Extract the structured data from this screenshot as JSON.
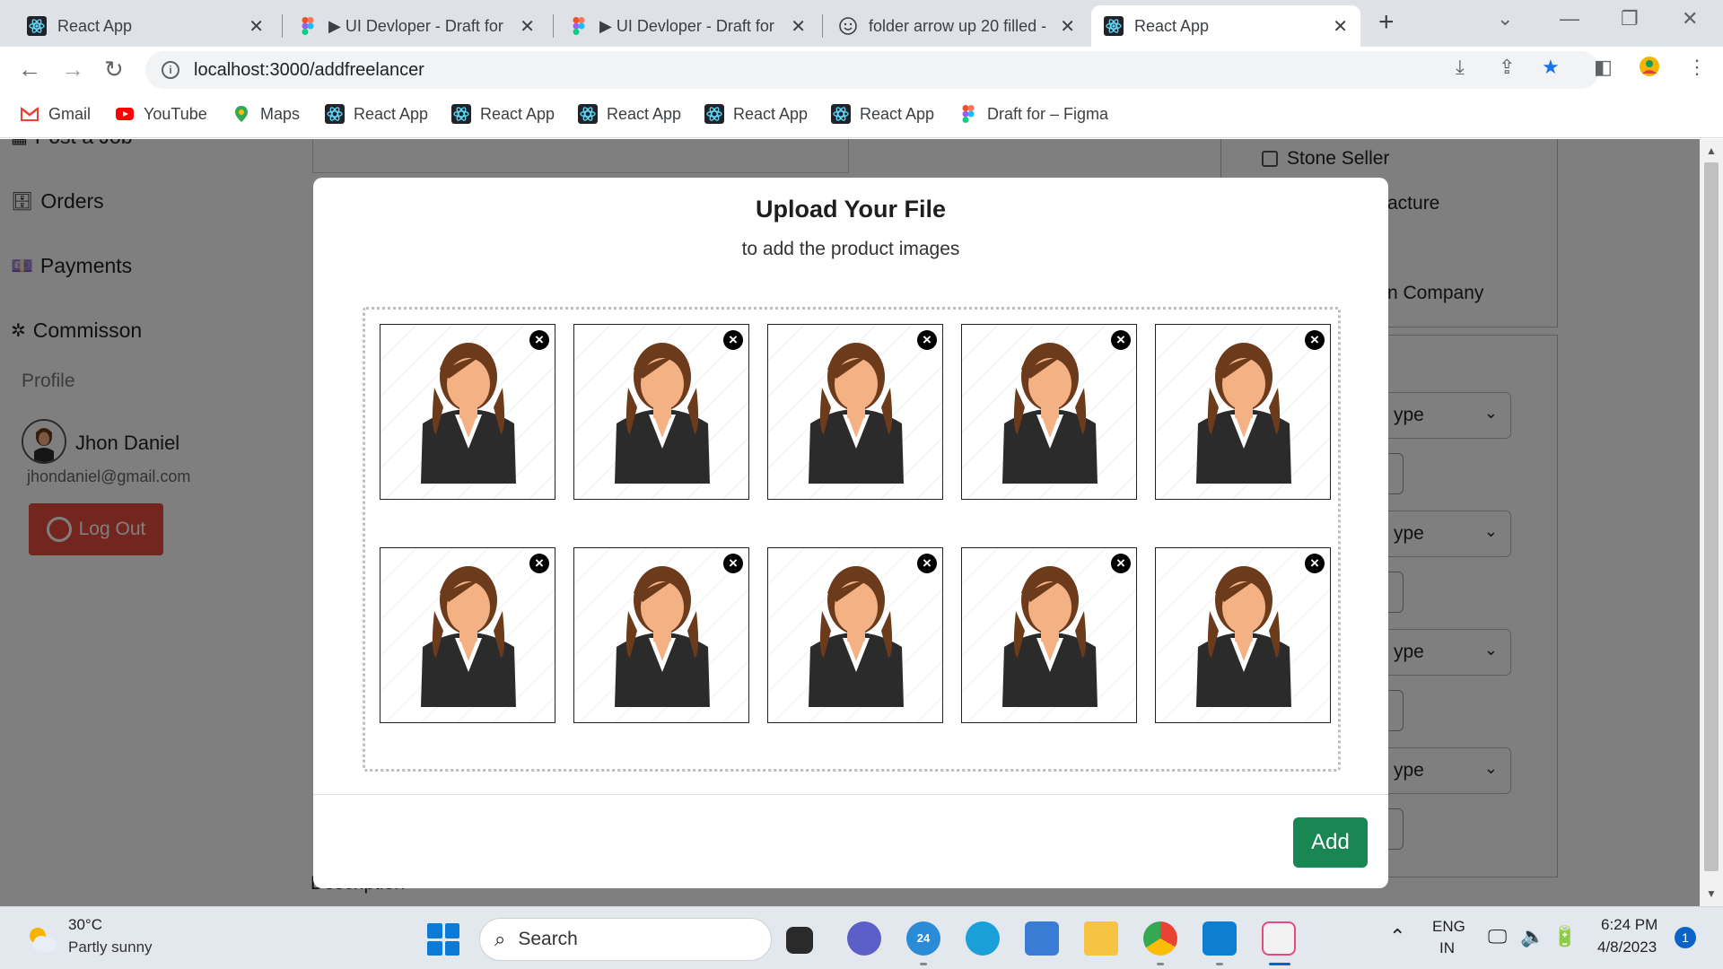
{
  "browser": {
    "tabs": [
      {
        "title": "React App",
        "icon": "react-icon"
      },
      {
        "title": "▶ UI Devloper - Draft for",
        "icon": "figma-icon"
      },
      {
        "title": "▶ UI Devloper - Draft for",
        "icon": "figma-icon"
      },
      {
        "title": "folder arrow up 20 filled -",
        "icon": "smiley-icon"
      },
      {
        "title": "React App",
        "icon": "react-icon",
        "active": true
      }
    ],
    "url": "localhost:3000/addfreelancer",
    "bookmarks": [
      {
        "label": "Gmail",
        "icon": "gmail-icon"
      },
      {
        "label": "YouTube",
        "icon": "youtube-icon"
      },
      {
        "label": "Maps",
        "icon": "maps-icon"
      },
      {
        "label": "React App",
        "icon": "react-icon"
      },
      {
        "label": "React App",
        "icon": "react-icon"
      },
      {
        "label": "React App",
        "icon": "react-icon"
      },
      {
        "label": "React App",
        "icon": "react-icon"
      },
      {
        "label": "React App",
        "icon": "react-icon"
      },
      {
        "label": "Draft for – Figma",
        "icon": "figma-icon"
      }
    ]
  },
  "sidebar": {
    "items": [
      {
        "label": "Post a Job"
      },
      {
        "label": "Orders"
      },
      {
        "label": "Payments"
      },
      {
        "label": "Commisson"
      }
    ],
    "profile_label": "Profile",
    "user_name": "Jhon Daniel",
    "user_email": "jhondaniel@gmail.com",
    "logout_label": "Log Out"
  },
  "background_form": {
    "checkbox_label": "Stone Seller",
    "partial_texts": [
      "acture",
      "n Company"
    ],
    "select_placeholder": "ype",
    "selects": [
      "ype",
      "ype",
      "ype",
      "ype"
    ],
    "description_label": "Description"
  },
  "modal": {
    "title": "Upload Your File",
    "subtitle": "to add the product images",
    "image_count": 10,
    "remove_symbol": "×",
    "add_label": "Add"
  },
  "taskbar": {
    "temperature": "30°C",
    "condition": "Partly sunny",
    "search_label": "Search",
    "language": "ENG",
    "region": "IN",
    "time": "6:24 PM",
    "date": "4/8/2023",
    "notifications": "1",
    "calendar_badge": "24"
  },
  "colors": {
    "add_button": "#198754",
    "logout_button": "#e74c3c",
    "overlay": "rgba(0,0,0,0.5)"
  }
}
